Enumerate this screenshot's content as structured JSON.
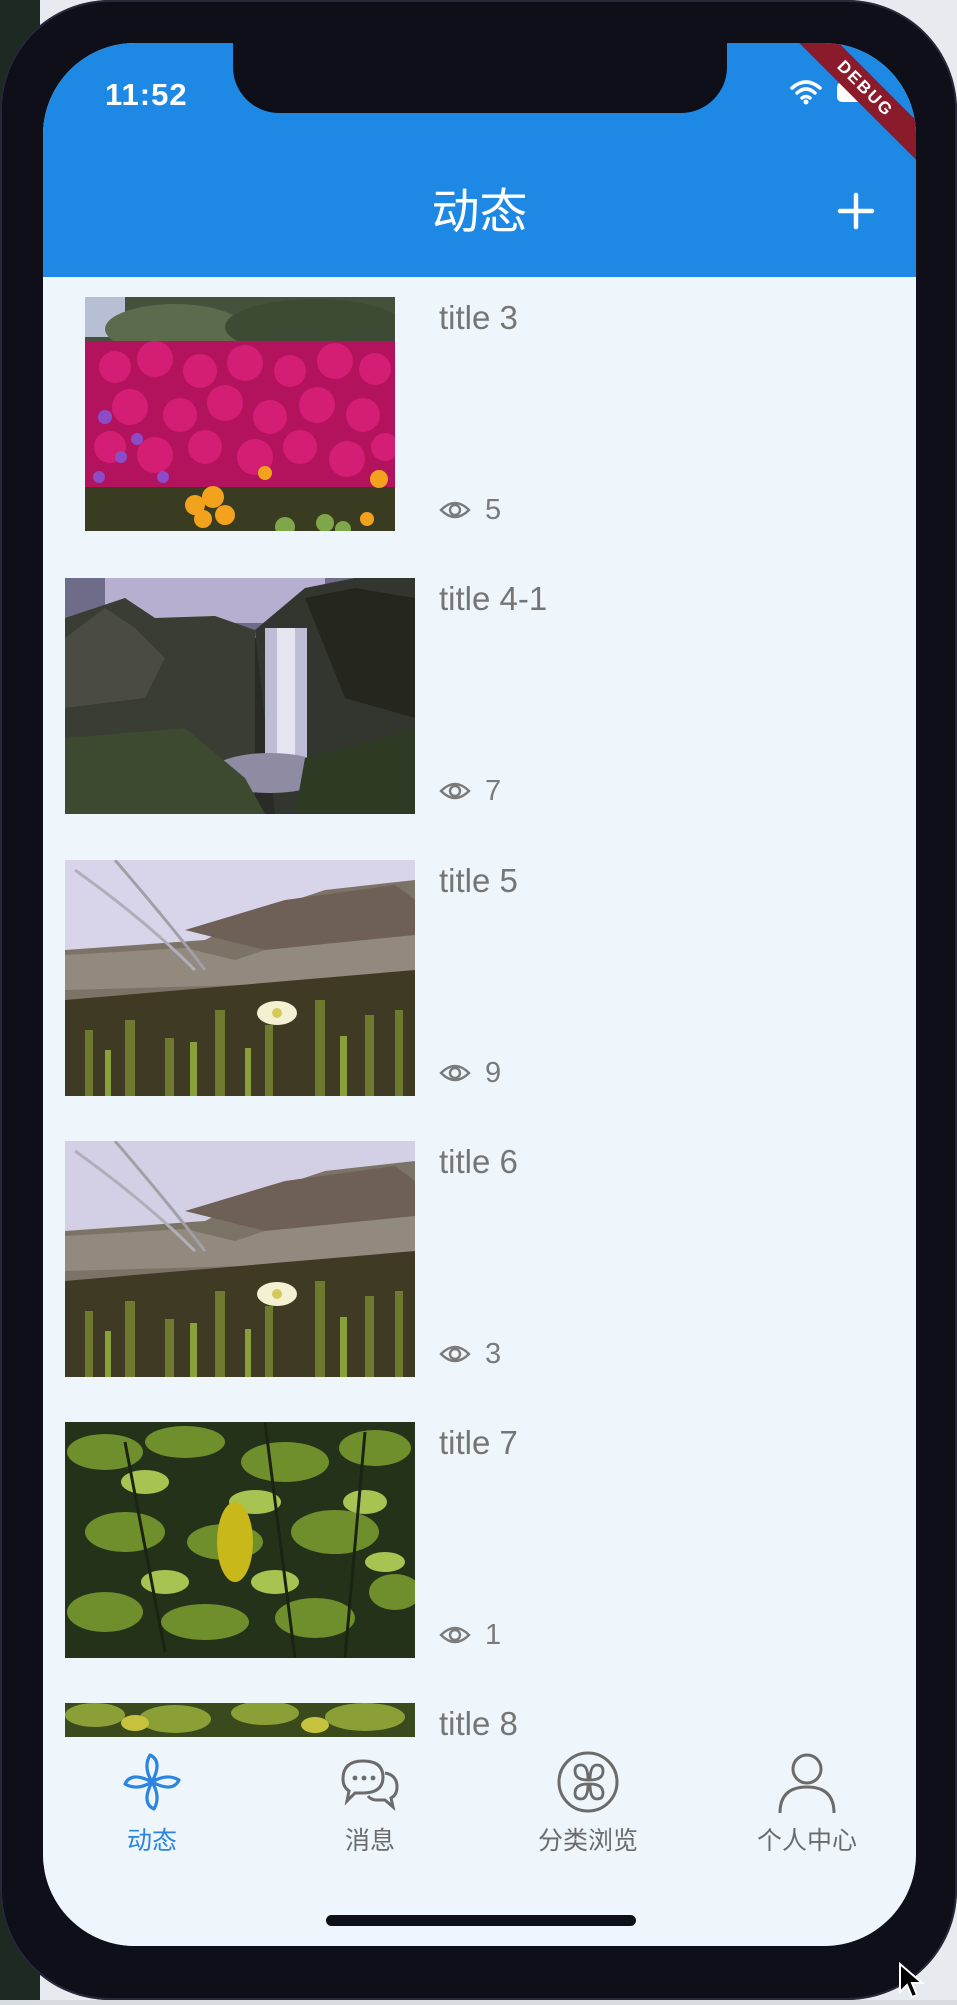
{
  "status_bar": {
    "time": "11:52",
    "debug_banner": "DEBUG"
  },
  "appbar": {
    "title": "动态",
    "add_icon": "plus-icon",
    "color": "#1e88e5"
  },
  "feed": {
    "items": [
      {
        "title": "title 3",
        "views": "5",
        "image": "magenta-flowers"
      },
      {
        "title": "title 4-1",
        "views": "7",
        "image": "waterfall"
      },
      {
        "title": "title 5",
        "views": "9",
        "image": "coastal-flower"
      },
      {
        "title": "title 6",
        "views": "3",
        "image": "coastal-flower"
      },
      {
        "title": "title 7",
        "views": "1",
        "image": "green-leaves"
      },
      {
        "title": "title 8",
        "views": "",
        "image": "yellow-green-plants"
      }
    ]
  },
  "bottom_nav": {
    "active_color": "#2a84e0",
    "items": [
      {
        "label": "动态",
        "icon": "pinwheel-icon",
        "active": true
      },
      {
        "label": "消息",
        "icon": "chat-bubbles-icon",
        "active": false
      },
      {
        "label": "分类浏览",
        "icon": "category-icon",
        "active": false
      },
      {
        "label": "个人中心",
        "icon": "person-icon",
        "active": false
      }
    ]
  }
}
